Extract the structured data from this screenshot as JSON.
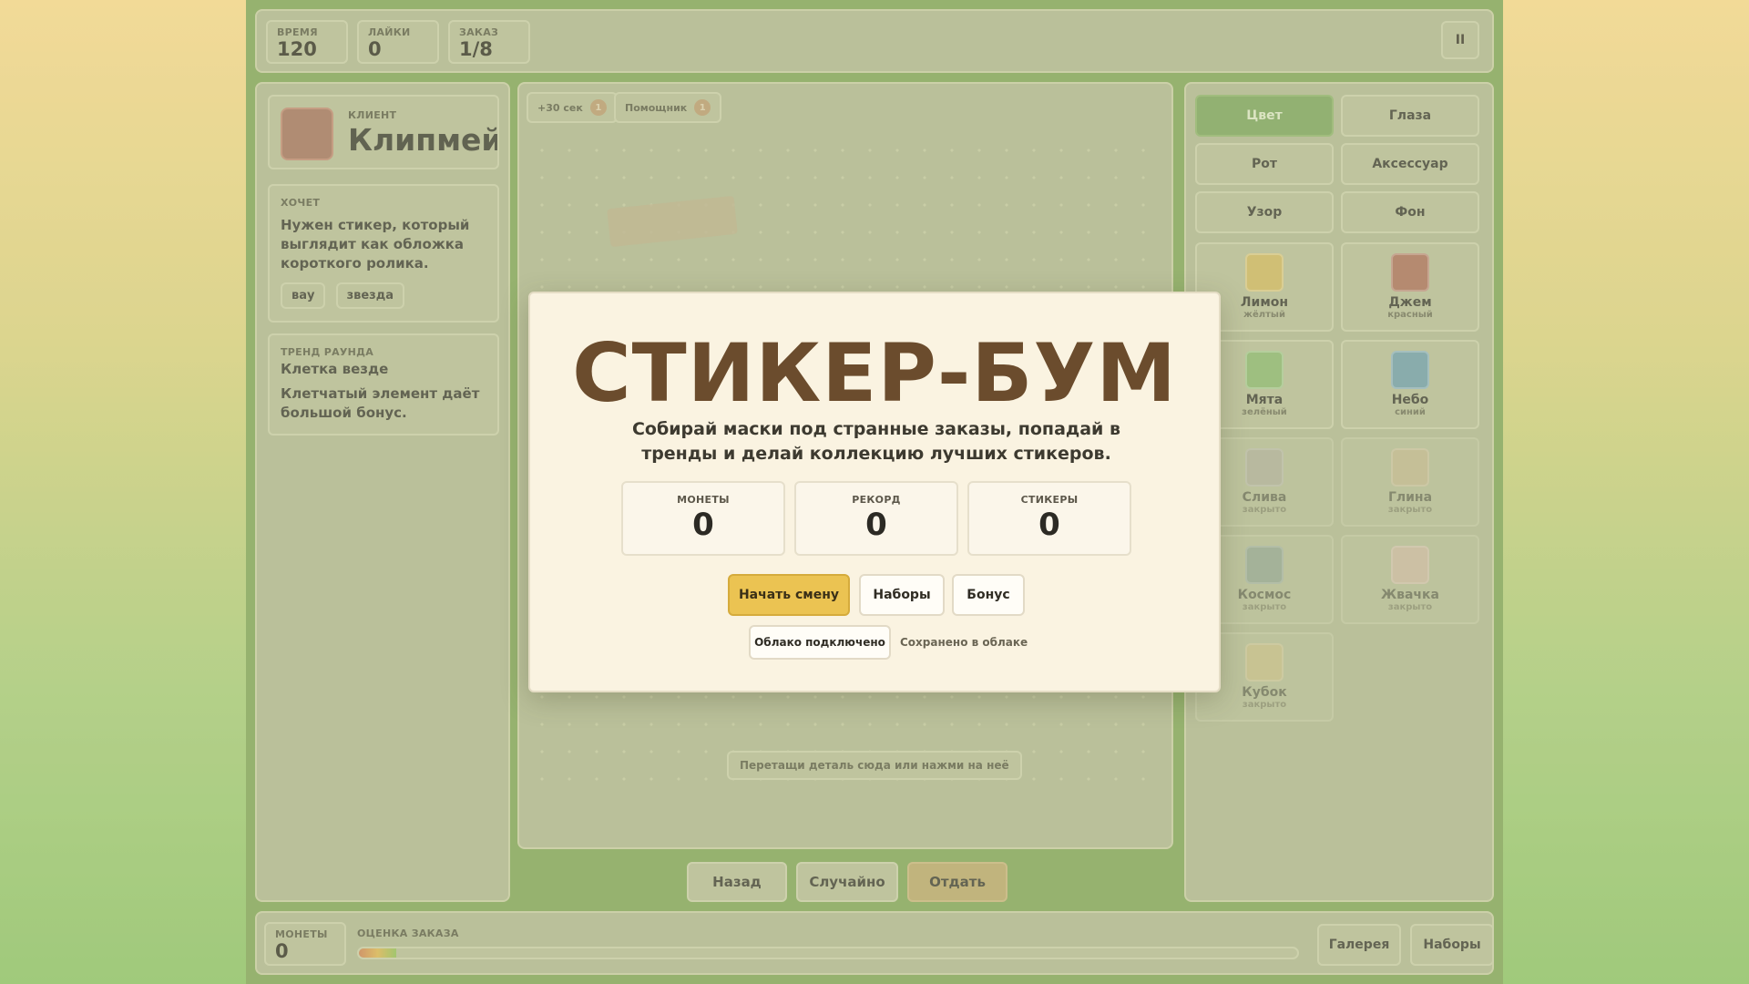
{
  "topbar": {
    "stats": [
      {
        "label": "ВРЕМЯ",
        "value": "120"
      },
      {
        "label": "ЛАЙКИ",
        "value": "0"
      },
      {
        "label": "ЗАКАЗ",
        "value": "1/8"
      }
    ],
    "pause_label": "II"
  },
  "client": {
    "caption": "КЛИЕНТ",
    "name": "Клипмейкс",
    "avatar_color": "#a0755c"
  },
  "wants": {
    "caption": "ХОЧЕТ",
    "text": "Нужен стикер, который выглядит как обложка короткого ролика.",
    "tags": [
      "вау",
      "звезда"
    ]
  },
  "trend": {
    "caption": "ТРЕНД РАУНДА",
    "title": "Клетка везде",
    "text": "Клетчатый элемент даёт большой бонус."
  },
  "boosts": [
    {
      "label": "+30 сек",
      "count": "1"
    },
    {
      "label": "Помощник",
      "count": "1"
    }
  ],
  "canvas": {
    "hint": "Перетащи деталь сюда или нажми на неё"
  },
  "actions": {
    "back": "Назад",
    "random": "Случайно",
    "give": "Отдать"
  },
  "categories": [
    {
      "label": "Цвет",
      "active": true
    },
    {
      "label": "Глаза",
      "active": false
    },
    {
      "label": "Рот",
      "active": false
    },
    {
      "label": "Аксессуар",
      "active": false
    },
    {
      "label": "Узор",
      "active": false
    },
    {
      "label": "Фон",
      "active": false
    }
  ],
  "swatches": [
    {
      "name": "Лимон",
      "sub": "жёлтый",
      "color": "#c9b75e",
      "locked": false
    },
    {
      "name": "Джем",
      "sub": "красный",
      "color": "#a77358",
      "locked": false
    },
    {
      "name": "Мята",
      "sub": "зелёный",
      "color": "#8ab76c",
      "locked": false
    },
    {
      "name": "Небо",
      "sub": "синий",
      "color": "#6f9ea4",
      "locked": false
    },
    {
      "name": "Слива",
      "sub": "закрыто",
      "color": "#aaaa99",
      "locked": true
    },
    {
      "name": "Глина",
      "sub": "закрыто",
      "color": "#c6b789",
      "locked": true
    },
    {
      "name": "Космос",
      "sub": "закрыто",
      "color": "#7f9b8c",
      "locked": true
    },
    {
      "name": "Жвачка",
      "sub": "закрыто",
      "color": "#d4b9a2",
      "locked": true
    },
    {
      "name": "Кубок",
      "sub": "закрыто",
      "color": "#cbbd7c",
      "locked": true
    }
  ],
  "bottombar": {
    "coins_label": "МОНЕТЫ",
    "coins_value": "0",
    "score_label": "ОЦЕНКА ЗАКАЗА",
    "score_fraction": 0.04,
    "gallery": "Галерея",
    "sets": "Наборы"
  },
  "modal": {
    "title": "СТИКЕР-БУМ",
    "subtitle": "Собирай маски под странные заказы, попадай в тренды и делай коллекцию лучших стикеров.",
    "stats": [
      {
        "label": "МОНЕТЫ",
        "value": "0"
      },
      {
        "label": "РЕКОРД",
        "value": "0"
      },
      {
        "label": "СТИКЕРЫ",
        "value": "0"
      }
    ],
    "start": "Начать смену",
    "sets": "Наборы",
    "bonus": "Бонус",
    "cloud_button": "Облако подключено",
    "cloud_status": "Сохранено в облаке"
  }
}
